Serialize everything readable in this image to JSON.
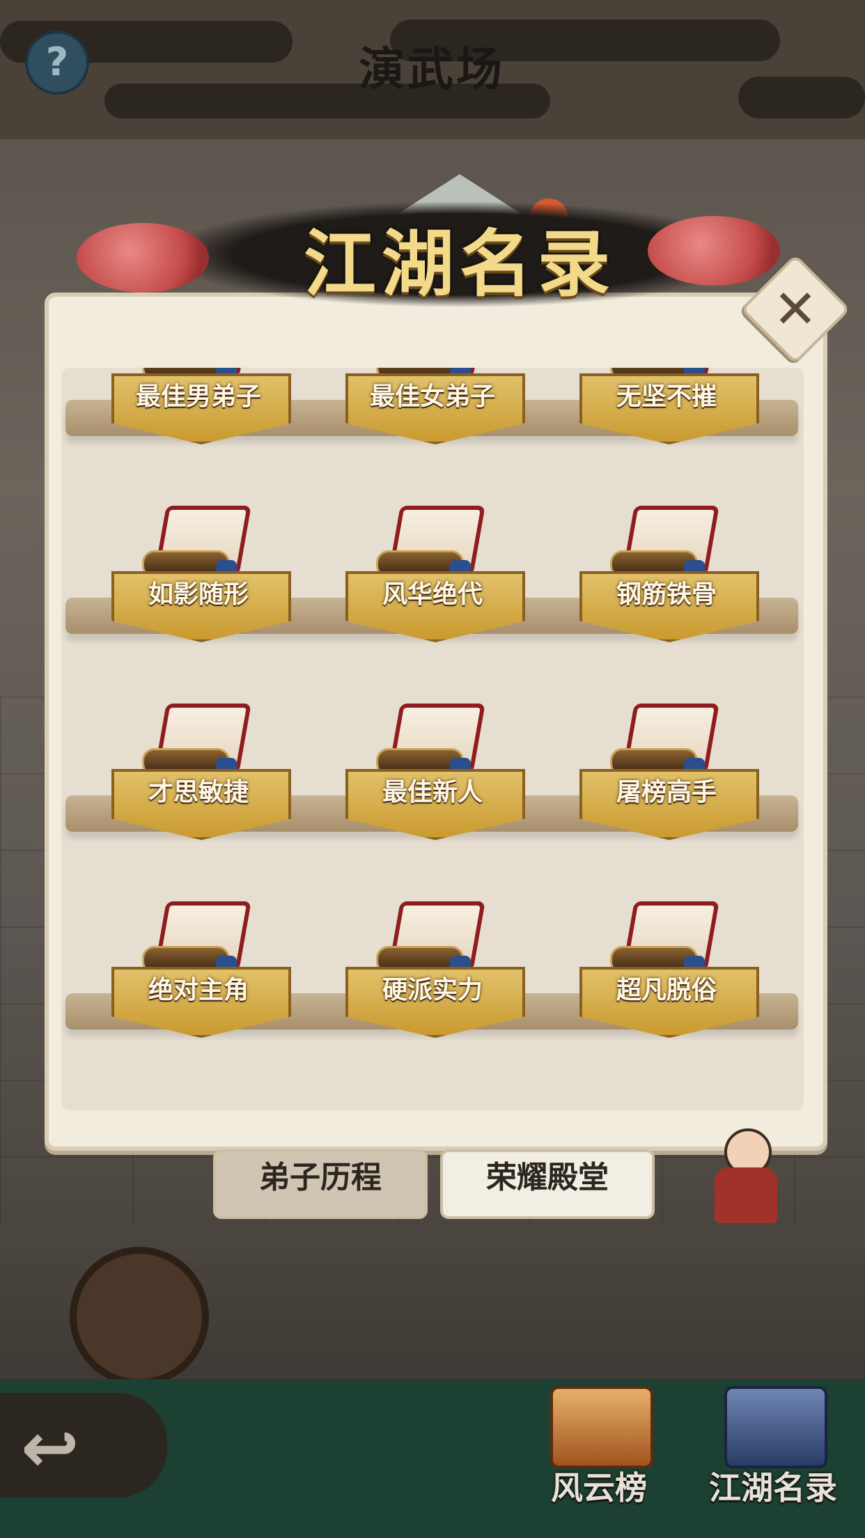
{
  "header": {
    "title": "演武场",
    "help_glyph": "?"
  },
  "banner": {
    "title": "江湖名录",
    "close_glyph": "✕"
  },
  "awards": [
    {
      "label": "最佳男弟子"
    },
    {
      "label": "最佳女弟子"
    },
    {
      "label": "无坚不摧"
    },
    {
      "label": "如影随形"
    },
    {
      "label": "风华绝代"
    },
    {
      "label": "钢筋铁骨"
    },
    {
      "label": "才思敏捷"
    },
    {
      "label": "最佳新人"
    },
    {
      "label": "屠榜高手"
    },
    {
      "label": "绝对主角"
    },
    {
      "label": "硬派实力"
    },
    {
      "label": "超凡脱俗"
    }
  ],
  "tabs": {
    "history": "弟子历程",
    "hall": "荣耀殿堂"
  },
  "bottom_nav": {
    "back_glyph": "↩",
    "ranking": "风云榜",
    "directory": "江湖名录"
  }
}
